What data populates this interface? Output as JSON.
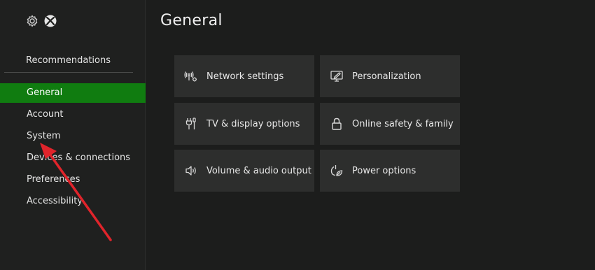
{
  "sidebar": {
    "recommendations": "Recommendations",
    "items": [
      {
        "label": "General",
        "active": true
      },
      {
        "label": "Account"
      },
      {
        "label": "System"
      },
      {
        "label": "Devices & connections"
      },
      {
        "label": "Preferences"
      },
      {
        "label": "Accessibility"
      }
    ]
  },
  "main": {
    "title": "General",
    "tiles": [
      {
        "label": "Network settings",
        "icon": "network-icon"
      },
      {
        "label": "Personalization",
        "icon": "personalization-icon"
      },
      {
        "label": "TV & display options",
        "icon": "tv-display-icon"
      },
      {
        "label": "Online safety & family",
        "icon": "lock-icon"
      },
      {
        "label": "Volume & audio output",
        "icon": "speaker-icon"
      },
      {
        "label": "Power options",
        "icon": "power-icon"
      }
    ]
  },
  "colors": {
    "accent": "#107c10",
    "annotation_arrow": "#e0242b",
    "tile_bg": "#2d2e2d",
    "background": "#1c1d1c"
  }
}
